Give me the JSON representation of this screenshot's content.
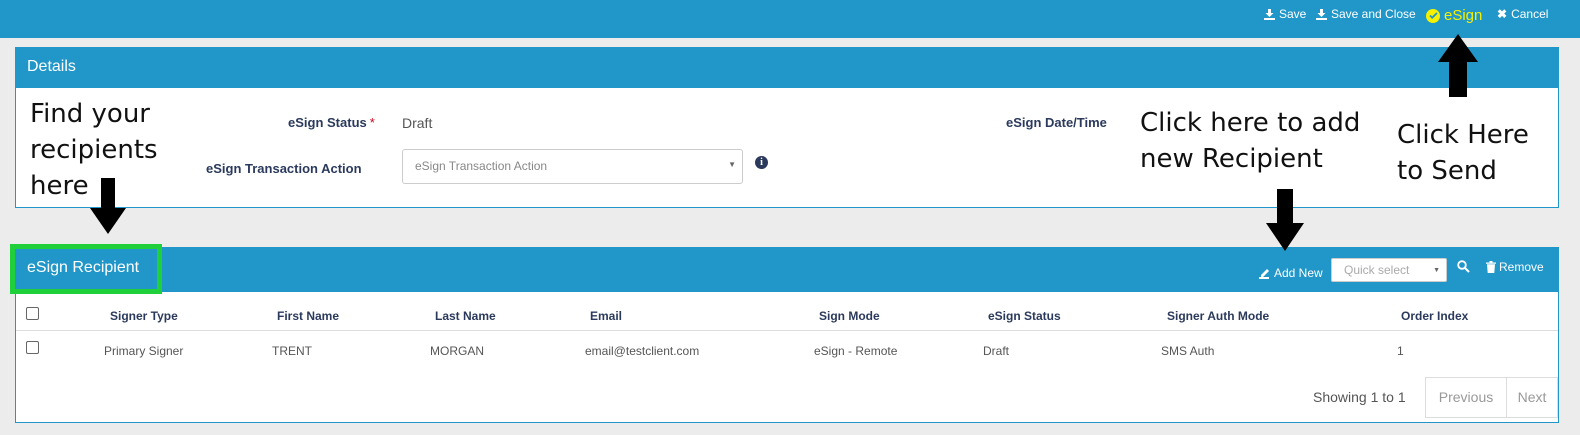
{
  "toolbar": {
    "save": "Save",
    "save_and_close": "Save and Close",
    "esign": "eSign",
    "cancel": "Cancel"
  },
  "details": {
    "title": "Details",
    "esign_status_label": "eSign Status",
    "esign_status_value": "Draft",
    "transaction_action_label": "eSign Transaction Action",
    "transaction_action_placeholder": "eSign Transaction Action",
    "esign_datetime_label": "eSign Date/Time"
  },
  "recipients": {
    "title": "eSign Recipient",
    "add_new": "Add New",
    "quick_select": "Quick select",
    "remove": "Remove",
    "columns": [
      "Signer Type",
      "First Name",
      "Last Name",
      "Email",
      "Sign Mode",
      "eSign Status",
      "Signer Auth Mode",
      "Order Index"
    ],
    "rows": [
      [
        "Primary Signer",
        "TRENT",
        "MORGAN",
        "email@testclient.com",
        "eSign - Remote",
        "Draft",
        "SMS Auth",
        "1"
      ]
    ],
    "showing": "Showing 1 to 1",
    "previous": "Previous",
    "next": "Next"
  },
  "annotations": {
    "find_recipients": [
      "Find your",
      "recipients",
      "here"
    ],
    "add_recipient": [
      "Click here to add",
      "new Recipient"
    ],
    "send": [
      "Click Here",
      "to Send"
    ]
  },
  "colors": {
    "header_blue": "#2196c8",
    "esign_yellow": "#f5f100",
    "highlight_green": "#1fd03a",
    "label_navy": "#2b3a5c"
  }
}
